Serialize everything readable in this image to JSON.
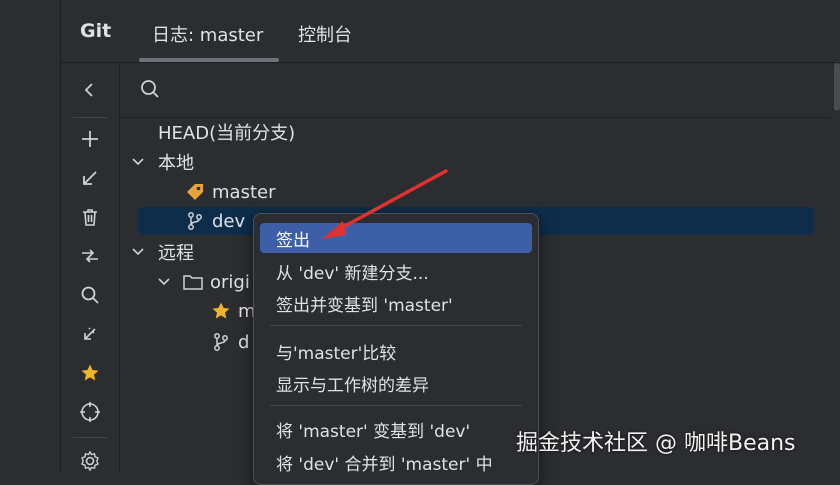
{
  "tabs": {
    "git": "Git",
    "log": "日志: master",
    "console": "控制台"
  },
  "search": {
    "placeholder": ""
  },
  "tree": {
    "head": "HEAD(当前分支)",
    "local": "本地",
    "local_master": "master",
    "local_dev": "dev",
    "remote": "远程",
    "origin": "origi",
    "origin_master": "m",
    "origin_dev": "d"
  },
  "menu": {
    "checkout": "签出",
    "new_branch": "从 'dev' 新建分支...",
    "checkout_rebase": "签出并变基到 'master'",
    "compare": "与'master'比较",
    "show_diff": "显示与工作树的差异",
    "rebase": "将 'master' 变基到 'dev'",
    "merge": "将 'dev' 合并到 'master' 中"
  },
  "watermark": "掘金技术社区 @ 咖啡Beans",
  "colors": {
    "selection": "#0e2d4a",
    "menu_active": "#3d5fa8",
    "arrow": "#e0322f",
    "tag": "#e8a33a",
    "star": "#f0b429"
  }
}
